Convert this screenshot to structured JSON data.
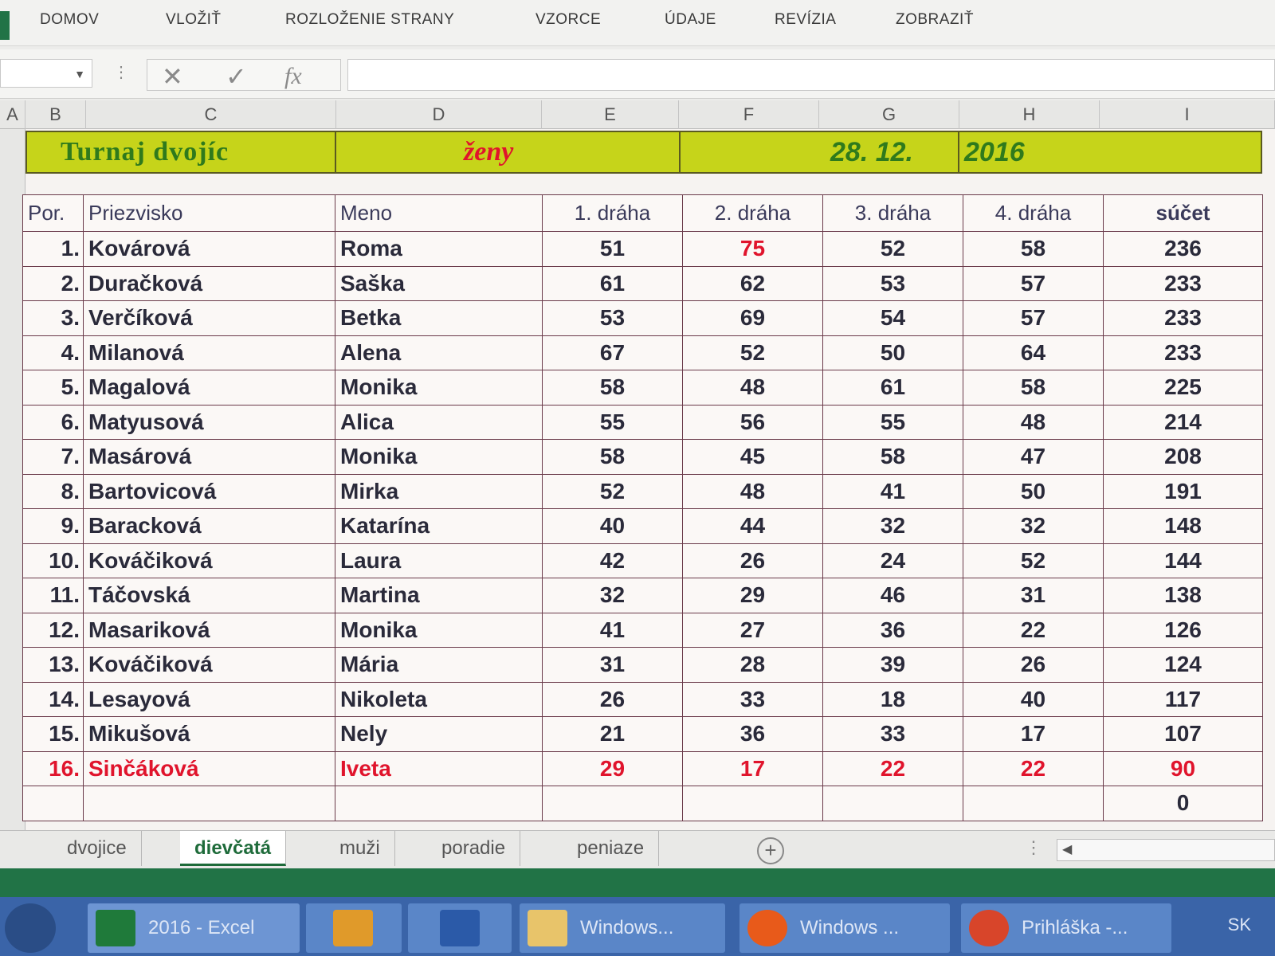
{
  "ribbon": {
    "tabs": [
      "DOMOV",
      "VLOŽIŤ",
      "ROZLOŽENIE STRANY",
      "VZORCE",
      "ÚDAJE",
      "REVÍZIA",
      "ZOBRAZIŤ"
    ]
  },
  "formula_bar": {
    "cancel_symbol": "✕",
    "enter_symbol": "✓",
    "fx_label": "fx"
  },
  "columns": [
    "A",
    "B",
    "C",
    "D",
    "E",
    "F",
    "G",
    "H",
    "I"
  ],
  "banner": {
    "title": "Turnaj dvojíc",
    "category": "ženy",
    "date": "28. 12.",
    "year": "2016"
  },
  "table": {
    "headers": [
      "Por.",
      "Priezvisko",
      "Meno",
      "1. dráha",
      "2. dráha",
      "3. dráha",
      "4. dráha",
      "súčet"
    ],
    "rows": [
      [
        "1.",
        "Kovárová",
        "Roma",
        "51",
        "75",
        "52",
        "58",
        "236"
      ],
      [
        "2.",
        "Duračková",
        "Saška",
        "61",
        "62",
        "53",
        "57",
        "233"
      ],
      [
        "3.",
        "Verčíková",
        "Betka",
        "53",
        "69",
        "54",
        "57",
        "233"
      ],
      [
        "4.",
        "Milanová",
        "Alena",
        "67",
        "52",
        "50",
        "64",
        "233"
      ],
      [
        "5.",
        "Magalová",
        "Monika",
        "58",
        "48",
        "61",
        "58",
        "225"
      ],
      [
        "6.",
        "Matyusová",
        "Alica",
        "55",
        "56",
        "55",
        "48",
        "214"
      ],
      [
        "7.",
        "Masárová",
        "Monika",
        "58",
        "45",
        "58",
        "47",
        "208"
      ],
      [
        "8.",
        "Bartovicová",
        "Mirka",
        "52",
        "48",
        "41",
        "50",
        "191"
      ],
      [
        "9.",
        "Baracková",
        "Katarína",
        "40",
        "44",
        "32",
        "32",
        "148"
      ],
      [
        "10.",
        "Kováčiková",
        "Laura",
        "42",
        "26",
        "24",
        "52",
        "144"
      ],
      [
        "11.",
        "Táčovská",
        "Martina",
        "32",
        "29",
        "46",
        "31",
        "138"
      ],
      [
        "12.",
        "Masariková",
        "Monika",
        "41",
        "27",
        "36",
        "22",
        "126"
      ],
      [
        "13.",
        "Kováčiková",
        "Mária",
        "31",
        "28",
        "39",
        "26",
        "124"
      ],
      [
        "14.",
        "Lesayová",
        "Nikoleta",
        "26",
        "33",
        "18",
        "40",
        "117"
      ],
      [
        "15.",
        "Mikušová",
        "Nely",
        "21",
        "36",
        "33",
        "17",
        "107"
      ],
      [
        "16.",
        "Sinčáková",
        "Iveta",
        "29",
        "17",
        "22",
        "22",
        "90"
      ]
    ],
    "extra_total": "0",
    "highlighted_row_index": 15
  },
  "sheets": {
    "tabs": [
      "dvojice",
      "dievčatá",
      "muži",
      "poradie",
      "peniaze"
    ],
    "active": "dievčatá",
    "add_symbol": "+"
  },
  "taskbar": {
    "items": [
      "2016 - Excel",
      "",
      "",
      "Windows...",
      "Windows ...",
      "Prihláška -..."
    ],
    "language": "SK"
  },
  "colors": {
    "banner_bg": "#c6d41a",
    "title_green": "#2f7a1c",
    "category_red": "#e0142c",
    "date_green": "#2f7a1c",
    "highlight_red": "#e0142c",
    "excel_green": "#217346",
    "taskbar_blue": "#3a64a8"
  }
}
